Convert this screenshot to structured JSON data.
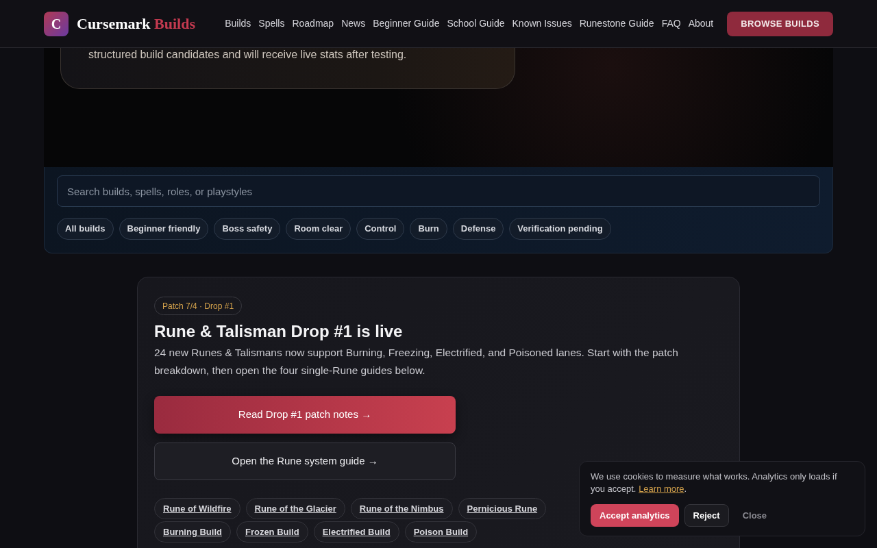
{
  "header": {
    "logo": {
      "mark": "C",
      "name": "Cursemark",
      "accent": "Builds"
    },
    "nav": [
      "Builds",
      "Spells",
      "Roadmap",
      "News",
      "Beginner Guide",
      "School Guide",
      "Known Issues",
      "Runestone Guide",
      "FAQ",
      "About"
    ],
    "cta": "BROWSE BUILDS"
  },
  "hero": {
    "text": "structured build candidates and will receive live stats after testing."
  },
  "filters": {
    "search": {
      "placeholder": "Search builds, spells, roles, or playstyles"
    },
    "chips": [
      "All builds",
      "Beginner friendly",
      "Boss safety",
      "Room clear",
      "Control",
      "Burn",
      "Defense",
      "Verification pending"
    ]
  },
  "announcement": {
    "tag": "Patch 7/4 · Drop #1",
    "title": "Rune & Talisman Drop #1 is live",
    "body": "24 new Runes & Talismans now support Burning, Freezing, Electrified, and Poisoned lanes. Start with the patch breakdown, then open the four single-Rune guides below.",
    "primary_button": "Read Drop #1 patch notes →",
    "secondary_button": "Open the Rune system guide →",
    "rune_links": [
      "Rune of Wildfire",
      "Rune of the Glacier",
      "Rune of the Nimbus",
      "Pernicious Rune"
    ],
    "build_links": [
      "Burning Build",
      "Frozen Build",
      "Electrified Build",
      "Poison Build"
    ]
  },
  "cookie_banner": {
    "text": "We use cookies to measure what works. Analytics only loads if you accept.",
    "link": "Learn more",
    "text_after": ".",
    "buttons": [
      {
        "label": "Accept analytics",
        "kind": "primary"
      },
      {
        "label": "Reject",
        "kind": "secondary"
      },
      {
        "label": "Close",
        "kind": "plain"
      }
    ]
  }
}
